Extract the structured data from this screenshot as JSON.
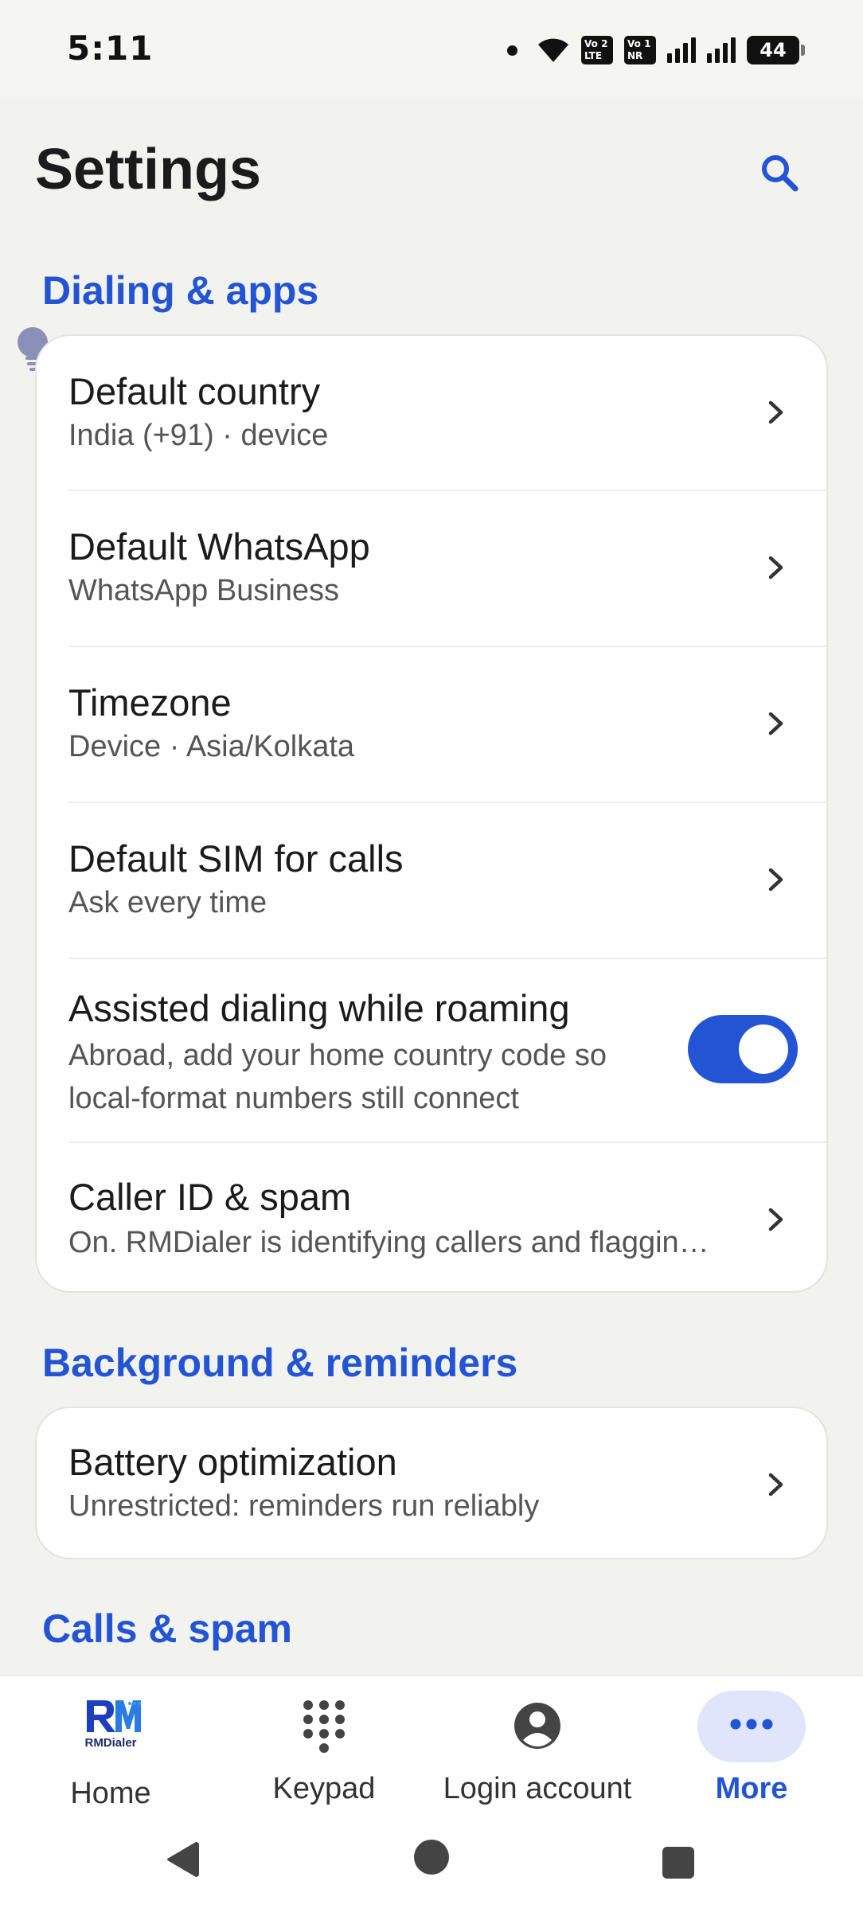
{
  "status_bar": {
    "time": "5:11",
    "battery": "44",
    "sim1_badge": [
      "Vo",
      "LTE",
      "2"
    ],
    "sim2_badge": [
      "Vo",
      "NR",
      "1"
    ]
  },
  "header": {
    "title": "Settings",
    "search_icon": "search-icon"
  },
  "sections": [
    {
      "title": "Dialing & apps",
      "items": [
        {
          "title": "Default country",
          "subtitle": "India (+91) · device",
          "control": "chevron"
        },
        {
          "title": "Default WhatsApp",
          "subtitle": "WhatsApp Business",
          "control": "chevron"
        },
        {
          "title": "Timezone",
          "subtitle": "Device · Asia/Kolkata",
          "control": "chevron"
        },
        {
          "title": "Default SIM for calls",
          "subtitle": "Ask every time",
          "control": "chevron"
        },
        {
          "title": "Assisted dialing while roaming",
          "subtitle_line1": "Abroad, add your home country code so",
          "subtitle_line2": "local-format numbers still connect",
          "control": "toggle",
          "enabled": true
        },
        {
          "title": "Caller ID & spam",
          "subtitle": "On. RMDialer is identifying callers and flaggin…",
          "control": "chevron"
        }
      ]
    },
    {
      "title": "Background & reminders",
      "items": [
        {
          "title": "Battery optimization",
          "subtitle": "Unrestricted: reminders run reliably",
          "control": "chevron"
        }
      ]
    },
    {
      "title": "Calls & spam",
      "items": []
    }
  ],
  "bottom_nav": {
    "items": [
      {
        "label": "Home",
        "icon": "rmdialer-logo-icon",
        "logo_text": "RMDialer",
        "active": false
      },
      {
        "label": "Keypad",
        "icon": "keypad-icon",
        "active": false
      },
      {
        "label": "Login account",
        "icon": "account-icon",
        "active": false
      },
      {
        "label": "More",
        "icon": "more-dots-icon",
        "active": true
      }
    ]
  },
  "colors": {
    "accent": "#2354d4",
    "background": "#f2f2ef",
    "card": "#ffffff",
    "more_pill": "#dfe6fb"
  }
}
